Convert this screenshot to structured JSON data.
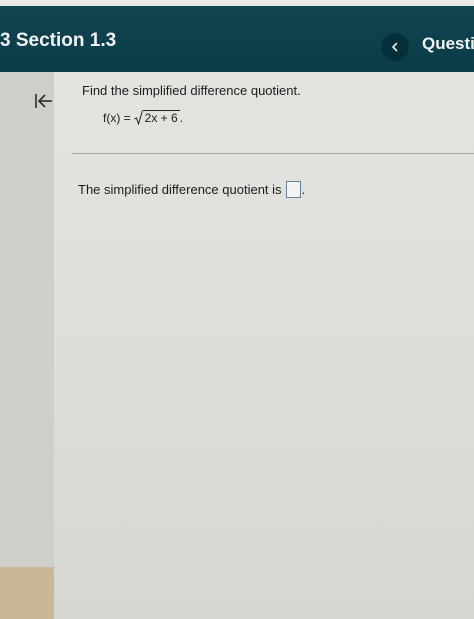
{
  "header": {
    "section_title": "3 Section 1.3",
    "questions_label": "Questio"
  },
  "question": {
    "prompt": "Find the simplified difference quotient.",
    "function_lhs": "f(x) =",
    "function_radicand": "2x + 6",
    "function_end": "."
  },
  "answer": {
    "prefix": "The simplified difference quotient is",
    "box_value": "",
    "suffix": "."
  },
  "colors": {
    "header_bg": "#0f4450",
    "header_text": "#f2f2f2",
    "prev_button_bg": "#063039",
    "answer_box_border": "#6b7f9a"
  },
  "icons": {
    "prev": "chevron-left-icon",
    "collapse": "collapse-left-icon"
  }
}
